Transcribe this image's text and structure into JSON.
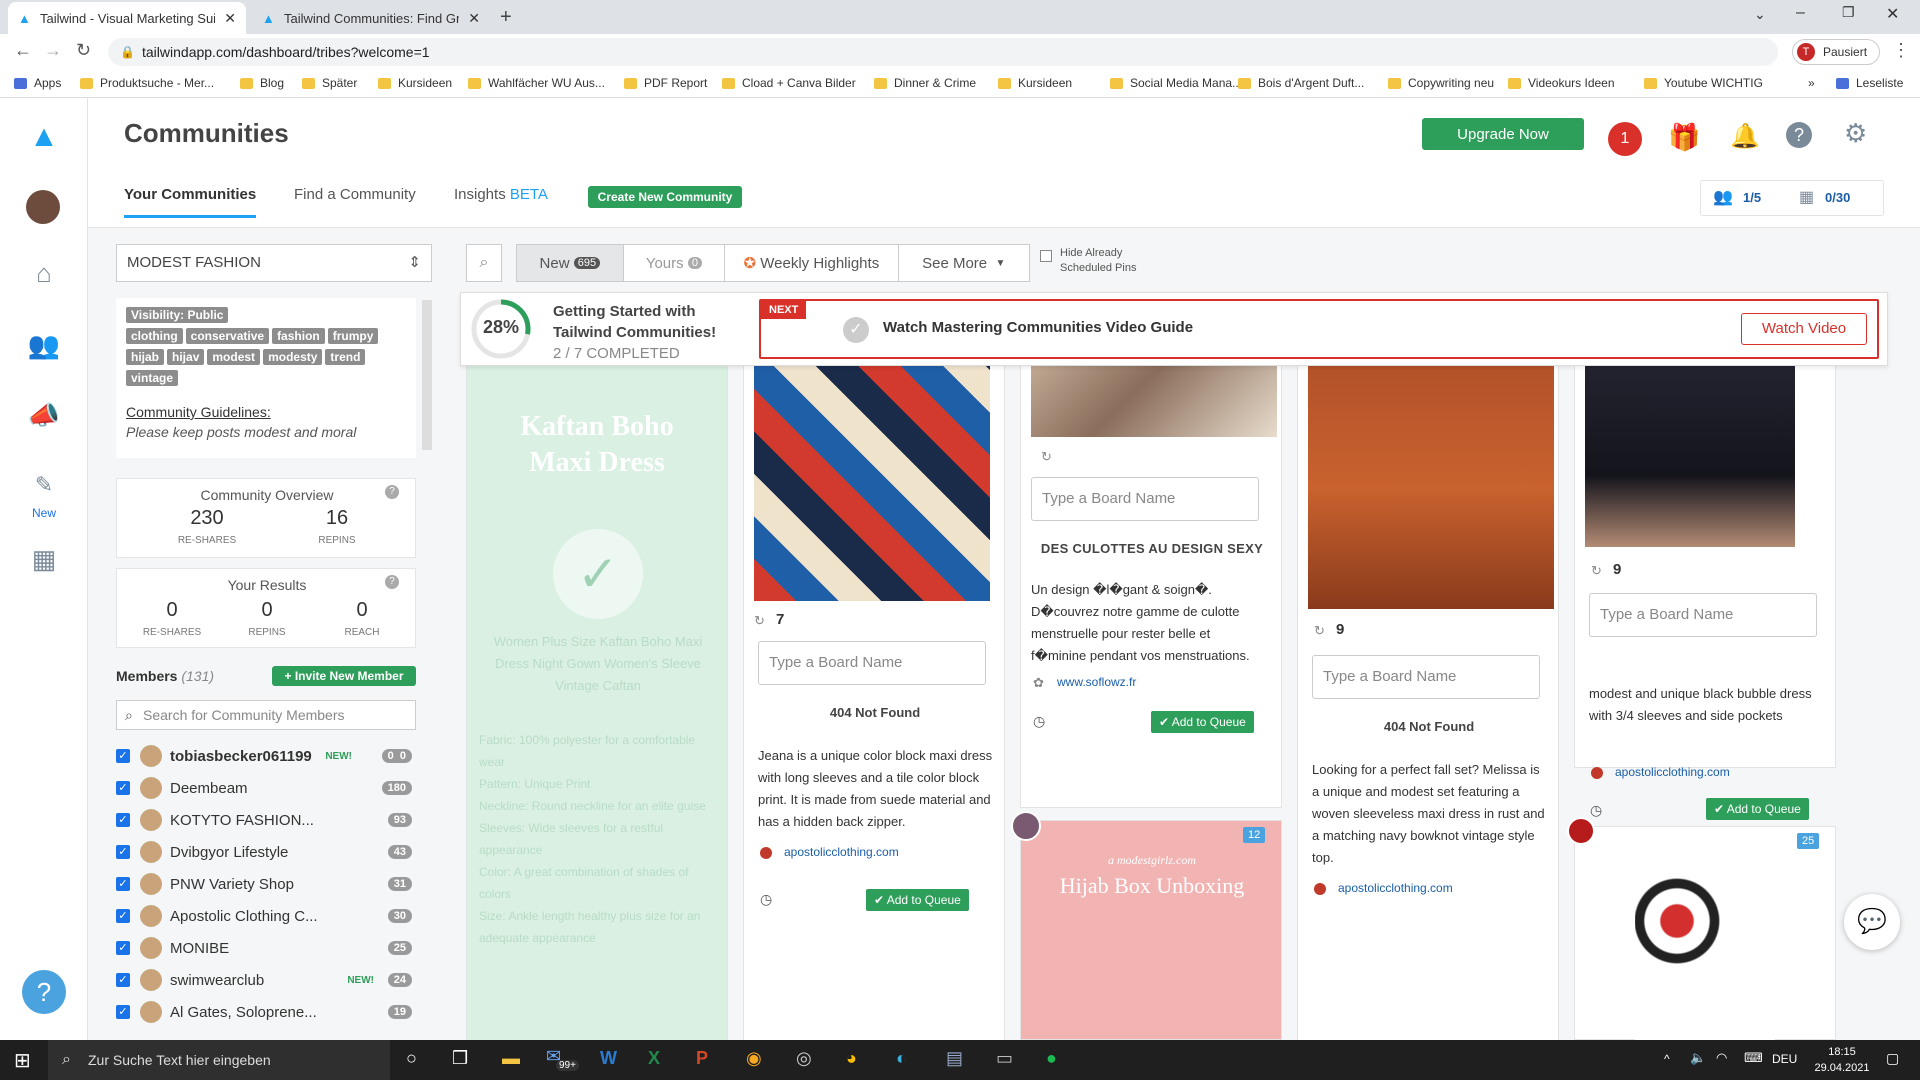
{
  "browser": {
    "tabs": [
      {
        "title": "Tailwind - Visual Marketing Suite"
      },
      {
        "title": "Tailwind Communities: Find Grea"
      }
    ],
    "url": "tailwindapp.com/dashboard/tribes?welcome=1",
    "profile_label": "Pausiert"
  },
  "bookmarks": [
    "Apps",
    "Produktsuche - Mer...",
    "Blog",
    "Später",
    "Kursideen",
    "Wahlfächer WU Aus...",
    "PDF Report",
    "Cload + Canva Bilder",
    "Dinner & Crime",
    "Kursideen",
    "Social Media Mana...",
    "Bois d'Argent Duft...",
    "Copywriting neu",
    "Videokurs Ideen",
    "Youtube WICHTIG",
    "Leseliste"
  ],
  "nav": {
    "new_label": "New"
  },
  "header": {
    "title": "Communities",
    "upgrade_label": "Upgrade Now",
    "notif_count": "1",
    "tabs": {
      "your": "Your Communities",
      "find": "Find a Community",
      "insights": "Insights",
      "beta": "BETA",
      "create": "Create New Community"
    },
    "usage1": "1/5",
    "usage2": "0/30"
  },
  "community": {
    "selected": "MODEST FASHION",
    "visibility": "Visibility: Public",
    "tags": [
      "clothing",
      "conservative",
      "fashion",
      "frumpy",
      "hijab",
      "hijav",
      "modest",
      "modesty",
      "trend",
      "vintage"
    ],
    "guidelines_label": "Community Guidelines:",
    "guidelines_text": "Please keep posts modest and moral"
  },
  "overview": {
    "title": "Community Overview",
    "reshares": "230",
    "reshares_label": "RE-SHARES",
    "repins": "16",
    "repins_label": "REPINS"
  },
  "results": {
    "title": "Your Results",
    "reshares": "0",
    "reshares_label": "RE-SHARES",
    "repins": "0",
    "repins_label": "REPINS",
    "reach": "0",
    "reach_label": "REACH"
  },
  "members": {
    "label": "Members",
    "count": "(131)",
    "invite": "Invite New Member",
    "search_placeholder": "Search for Community Members",
    "list": [
      {
        "name": "tobiasbecker061199",
        "new": "NEW!",
        "c1": "0",
        "c2": "0"
      },
      {
        "name": "Deembeam",
        "count": "180"
      },
      {
        "name": "KOTYTO FASHION...",
        "count": "93"
      },
      {
        "name": "Dvibgyor Lifestyle",
        "count": "43"
      },
      {
        "name": "PNW Variety Shop",
        "count": "31"
      },
      {
        "name": "Apostolic Clothing C...",
        "count": "30"
      },
      {
        "name": "MONIBE",
        "count": "25"
      },
      {
        "name": "swimwearclub",
        "new": "NEW!",
        "count": "24"
      },
      {
        "name": "Al Gates, Soloprene...",
        "count": "19"
      }
    ]
  },
  "filters": {
    "new": "New",
    "new_count": "695",
    "yours": "Yours",
    "yours_count": "0",
    "weekly": "Weekly Highlights",
    "see_more": "See More",
    "hide": "Hide Already Scheduled Pins"
  },
  "banner": {
    "percent": "28%",
    "progress": 0.28,
    "title": "Getting Started with Tailwind Communities!",
    "completed": "2 / 7 COMPLETED",
    "next": "NEXT",
    "task": "Watch Mastering Communities Video Guide",
    "watch": "Watch Video"
  },
  "pins": {
    "board_placeholder": "Type a Board Name",
    "add": "Add to Queue",
    "p0": {
      "title": "Kaftan Boho Maxi Dress",
      "desc": "Women Plus Size Kaftan Boho Maxi Dress Night Gown Women's Sleeve Vintage Caftan",
      "specs": [
        "Fabric: 100% polyester for a comfortable wear",
        "Pattern: Unique Print",
        "Neckline: Round neckline for an elite guise",
        "Sleeves: Wide sleeves for a restful appearance",
        "Color: A great combination of shades of colors",
        "Size: Ankle length healthy plus size for an adequate appearance"
      ]
    },
    "p1": {
      "repins": "7",
      "nf": "404 Not Found",
      "desc": "Jeana is a unique color block maxi dress with long sleeves and a tile color block print. It is made from suede material and has a hidden back zipper.",
      "link": "apostolicclothing.com"
    },
    "p2": {
      "title": "DES CULOTTES AU DESIGN SEXY",
      "desc": "Un design �l�gant & soign�. D�couvrez notre gamme de culotte menstruelle pour rester belle et f�minine pendant vos menstruations.",
      "link": "www.soflowz.fr",
      "promo": "a modestgirlz.com",
      "promo_title": "Hijab Box Unboxing",
      "promo_count": "12"
    },
    "p3": {
      "repins": "9",
      "nf": "404 Not Found",
      "desc": "Looking for a perfect fall set? Melissa is a unique and modest set featuring a woven sleeveless maxi dress in rust and a matching navy bowknot vintage style top.",
      "link": "apostolicclothing.com"
    },
    "p4": {
      "repins": "9",
      "desc": "modest and unique black bubble dress with 3/4 sleeves and side pockets",
      "link": "apostolicclothing.com",
      "count2": "25"
    }
  },
  "taskbar": {
    "search": "Zur Suche Text hier eingeben",
    "lang": "DEU",
    "time": "18:15",
    "date": "29.04.2021",
    "badge": "99+"
  }
}
